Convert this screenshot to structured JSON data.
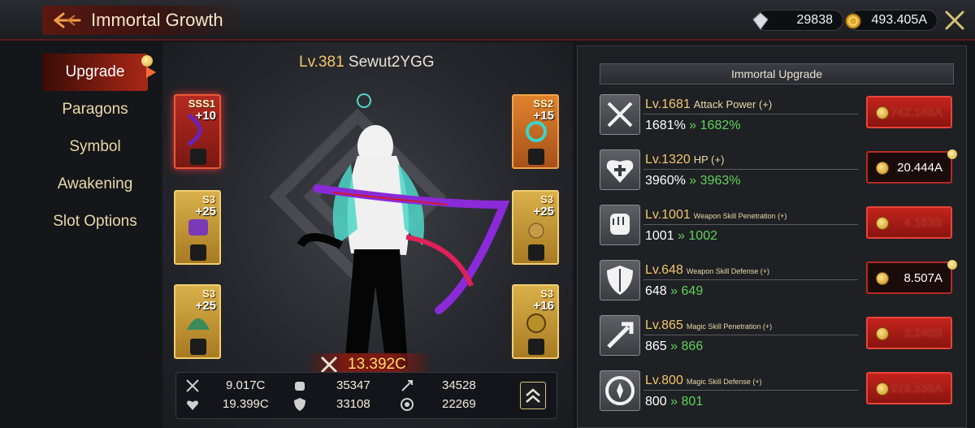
{
  "header": {
    "title": "Immortal Growth",
    "gems": "29838",
    "gold": "493.405A"
  },
  "nav": {
    "items": [
      {
        "label": "Upgrade",
        "active": true
      },
      {
        "label": "Paragons"
      },
      {
        "label": "Symbol"
      },
      {
        "label": "Awakening"
      },
      {
        "label": "Slot Options"
      }
    ]
  },
  "character": {
    "level": "Lv.381",
    "name": "Sewut2YGG",
    "combat_power": "13.392C",
    "slots": [
      {
        "grade": "SSS1",
        "plus": "+10",
        "color": "red",
        "badge": "swords-icon"
      },
      {
        "grade": "SS2",
        "plus": "+15",
        "color": "orange",
        "badge": "heart-cross-icon"
      },
      {
        "grade": "S3",
        "plus": "+25",
        "color": "gold",
        "badge": "fist-icon"
      },
      {
        "grade": "S3",
        "plus": "+25",
        "color": "gold",
        "badge": "shield-icon"
      },
      {
        "grade": "S3",
        "plus": "+25",
        "color": "gold",
        "badge": "magic-penetration-icon"
      },
      {
        "grade": "S3",
        "plus": "+16",
        "color": "gold",
        "badge": "magic-defense-icon"
      }
    ],
    "stats": {
      "attack": "9.017C",
      "hp": "19.399C",
      "weapon_pen": "35347",
      "weapon_def": "33108",
      "magic_pen": "34528",
      "magic_def": "22269"
    }
  },
  "upgrade": {
    "header": "Immortal Upgrade",
    "rows": [
      {
        "level": "Lv.1681",
        "name": "Attack Power (+)",
        "current": "1681%",
        "next": "1682%",
        "cost": "742.145A",
        "affordable": false,
        "icon": "swords-icon"
      },
      {
        "level": "Lv.1320",
        "name": "HP (+)",
        "current": "3960%",
        "next": "3963%",
        "cost": "20.444A",
        "affordable": true,
        "icon": "heart-cross-icon"
      },
      {
        "level": "Lv.1001",
        "name": "Weapon Skill Penetration (+)",
        "current": "1001",
        "next": "1002",
        "cost": "4.163B",
        "affordable": false,
        "icon": "fist-icon"
      },
      {
        "level": "Lv.648",
        "name": "Weapon Skill Defense (+)",
        "current": "648",
        "next": "649",
        "cost": "8.507A",
        "affordable": true,
        "icon": "shield-icon"
      },
      {
        "level": "Lv.865",
        "name": "Magic Skill Penetration (+)",
        "current": "865",
        "next": "866",
        "cost": "3.240B",
        "affordable": false,
        "icon": "magic-penetration-icon"
      },
      {
        "level": "Lv.800",
        "name": "Magic Skill Defense (+)",
        "current": "800",
        "next": "801",
        "cost": "929.538A",
        "affordable": false,
        "icon": "magic-defense-icon"
      }
    ]
  },
  "colors": {
    "accent_red": "#c3231c",
    "gold_text": "#f1c76a",
    "next_value_green": "#5fd35a"
  }
}
